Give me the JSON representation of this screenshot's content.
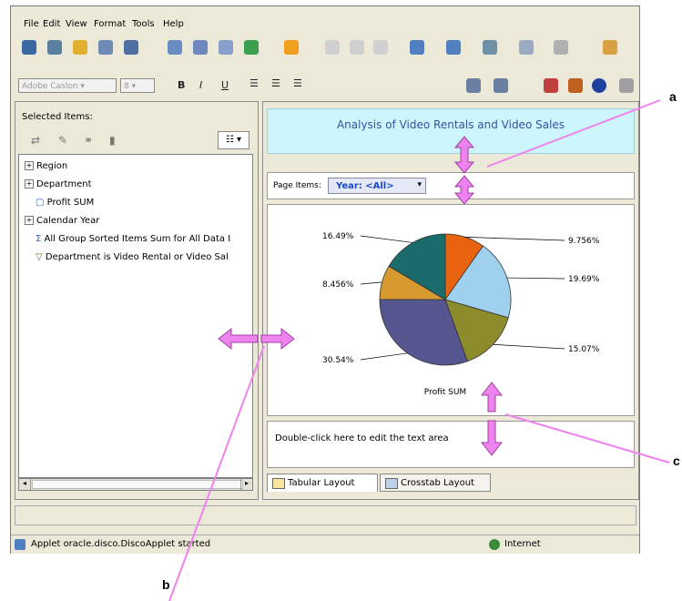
{
  "menu": [
    "File",
    "Edit",
    "View",
    "Format",
    "Tools",
    "Help"
  ],
  "format_toolbar": {
    "font_name": "Adobe Caslon",
    "font_size": "8",
    "bold": "B",
    "italic": "I",
    "underline": "U"
  },
  "left_panel": {
    "title": "Selected Items:",
    "items": [
      "Region",
      "Department",
      "Profit SUM",
      "Calendar Year",
      "All Group Sorted Items Sum for All Data I",
      "Department is Video Rental or Video Sal"
    ]
  },
  "report": {
    "title": "Analysis of Video Rentals and Video Sales",
    "page_items_label": "Page Items:",
    "page_item_value": "Year: <All>",
    "text_area": "Double-click here to edit the text area"
  },
  "chart_data": {
    "type": "pie",
    "title": "",
    "xlabel": "Profit SUM",
    "slices": [
      {
        "label": "9.756%",
        "value": 9.756,
        "color": "#e8640f"
      },
      {
        "label": "19.69%",
        "value": 19.69,
        "color": "#9fd1ef"
      },
      {
        "label": "15.07%",
        "value": 15.07,
        "color": "#8c8c2c"
      },
      {
        "label": "30.54%",
        "value": 30.54,
        "color": "#55558f"
      },
      {
        "label": "8.456%",
        "value": 8.456,
        "color": "#d89a30"
      },
      {
        "label": "16.49%",
        "value": 16.49,
        "color": "#1a6b6b"
      }
    ]
  },
  "tabs": [
    "Tabular Layout",
    "Crosstab Layout"
  ],
  "status": {
    "left": "Applet oracle.disco.DiscoApplet started",
    "right": "Internet"
  },
  "annotations": [
    "a",
    "b",
    "c"
  ],
  "colors": {
    "annotation_arrow": "#ee82ee",
    "title_bg": "#ccf6fb",
    "title_text": "#3a4fa8"
  }
}
